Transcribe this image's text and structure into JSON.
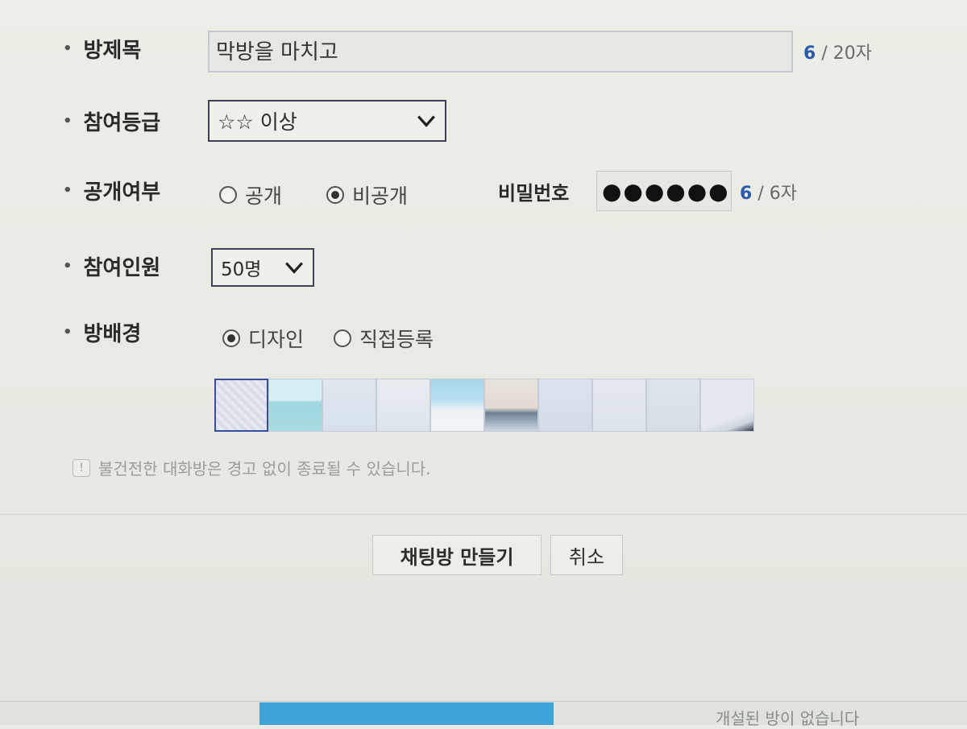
{
  "form": {
    "room_title": {
      "label": "방제목",
      "value": "막방을 마치고",
      "count_current": "6",
      "count_max": "/ 20자"
    },
    "grade": {
      "label": "참여등급",
      "selected": "☆☆ 이상"
    },
    "visibility": {
      "label": "공개여부",
      "option_public": "공개",
      "option_private": "비공개",
      "selected": "비공개"
    },
    "password": {
      "label": "비밀번호",
      "masked_value": "●●●●●●",
      "count_current": "6",
      "count_max": "/ 6자"
    },
    "capacity": {
      "label": "참여인원",
      "selected": "50명"
    },
    "background": {
      "label": "방배경",
      "option_design": "디자인",
      "option_custom": "직접등록",
      "selected": "디자인",
      "selected_thumb": 0
    },
    "notice": "불건전한 대화방은 경고 없이 종료될 수 있습니다."
  },
  "buttons": {
    "create": "채팅방 만들기",
    "cancel": "취소"
  },
  "footer": {
    "partial_text": "개설된 방이 없습니다"
  },
  "colors": {
    "accent_blue": "#2f5aa8",
    "bar_blue": "#3fa3d6"
  },
  "icons": {
    "select_arrow": "chevron-down-icon",
    "notice": "exclamation-icon"
  }
}
